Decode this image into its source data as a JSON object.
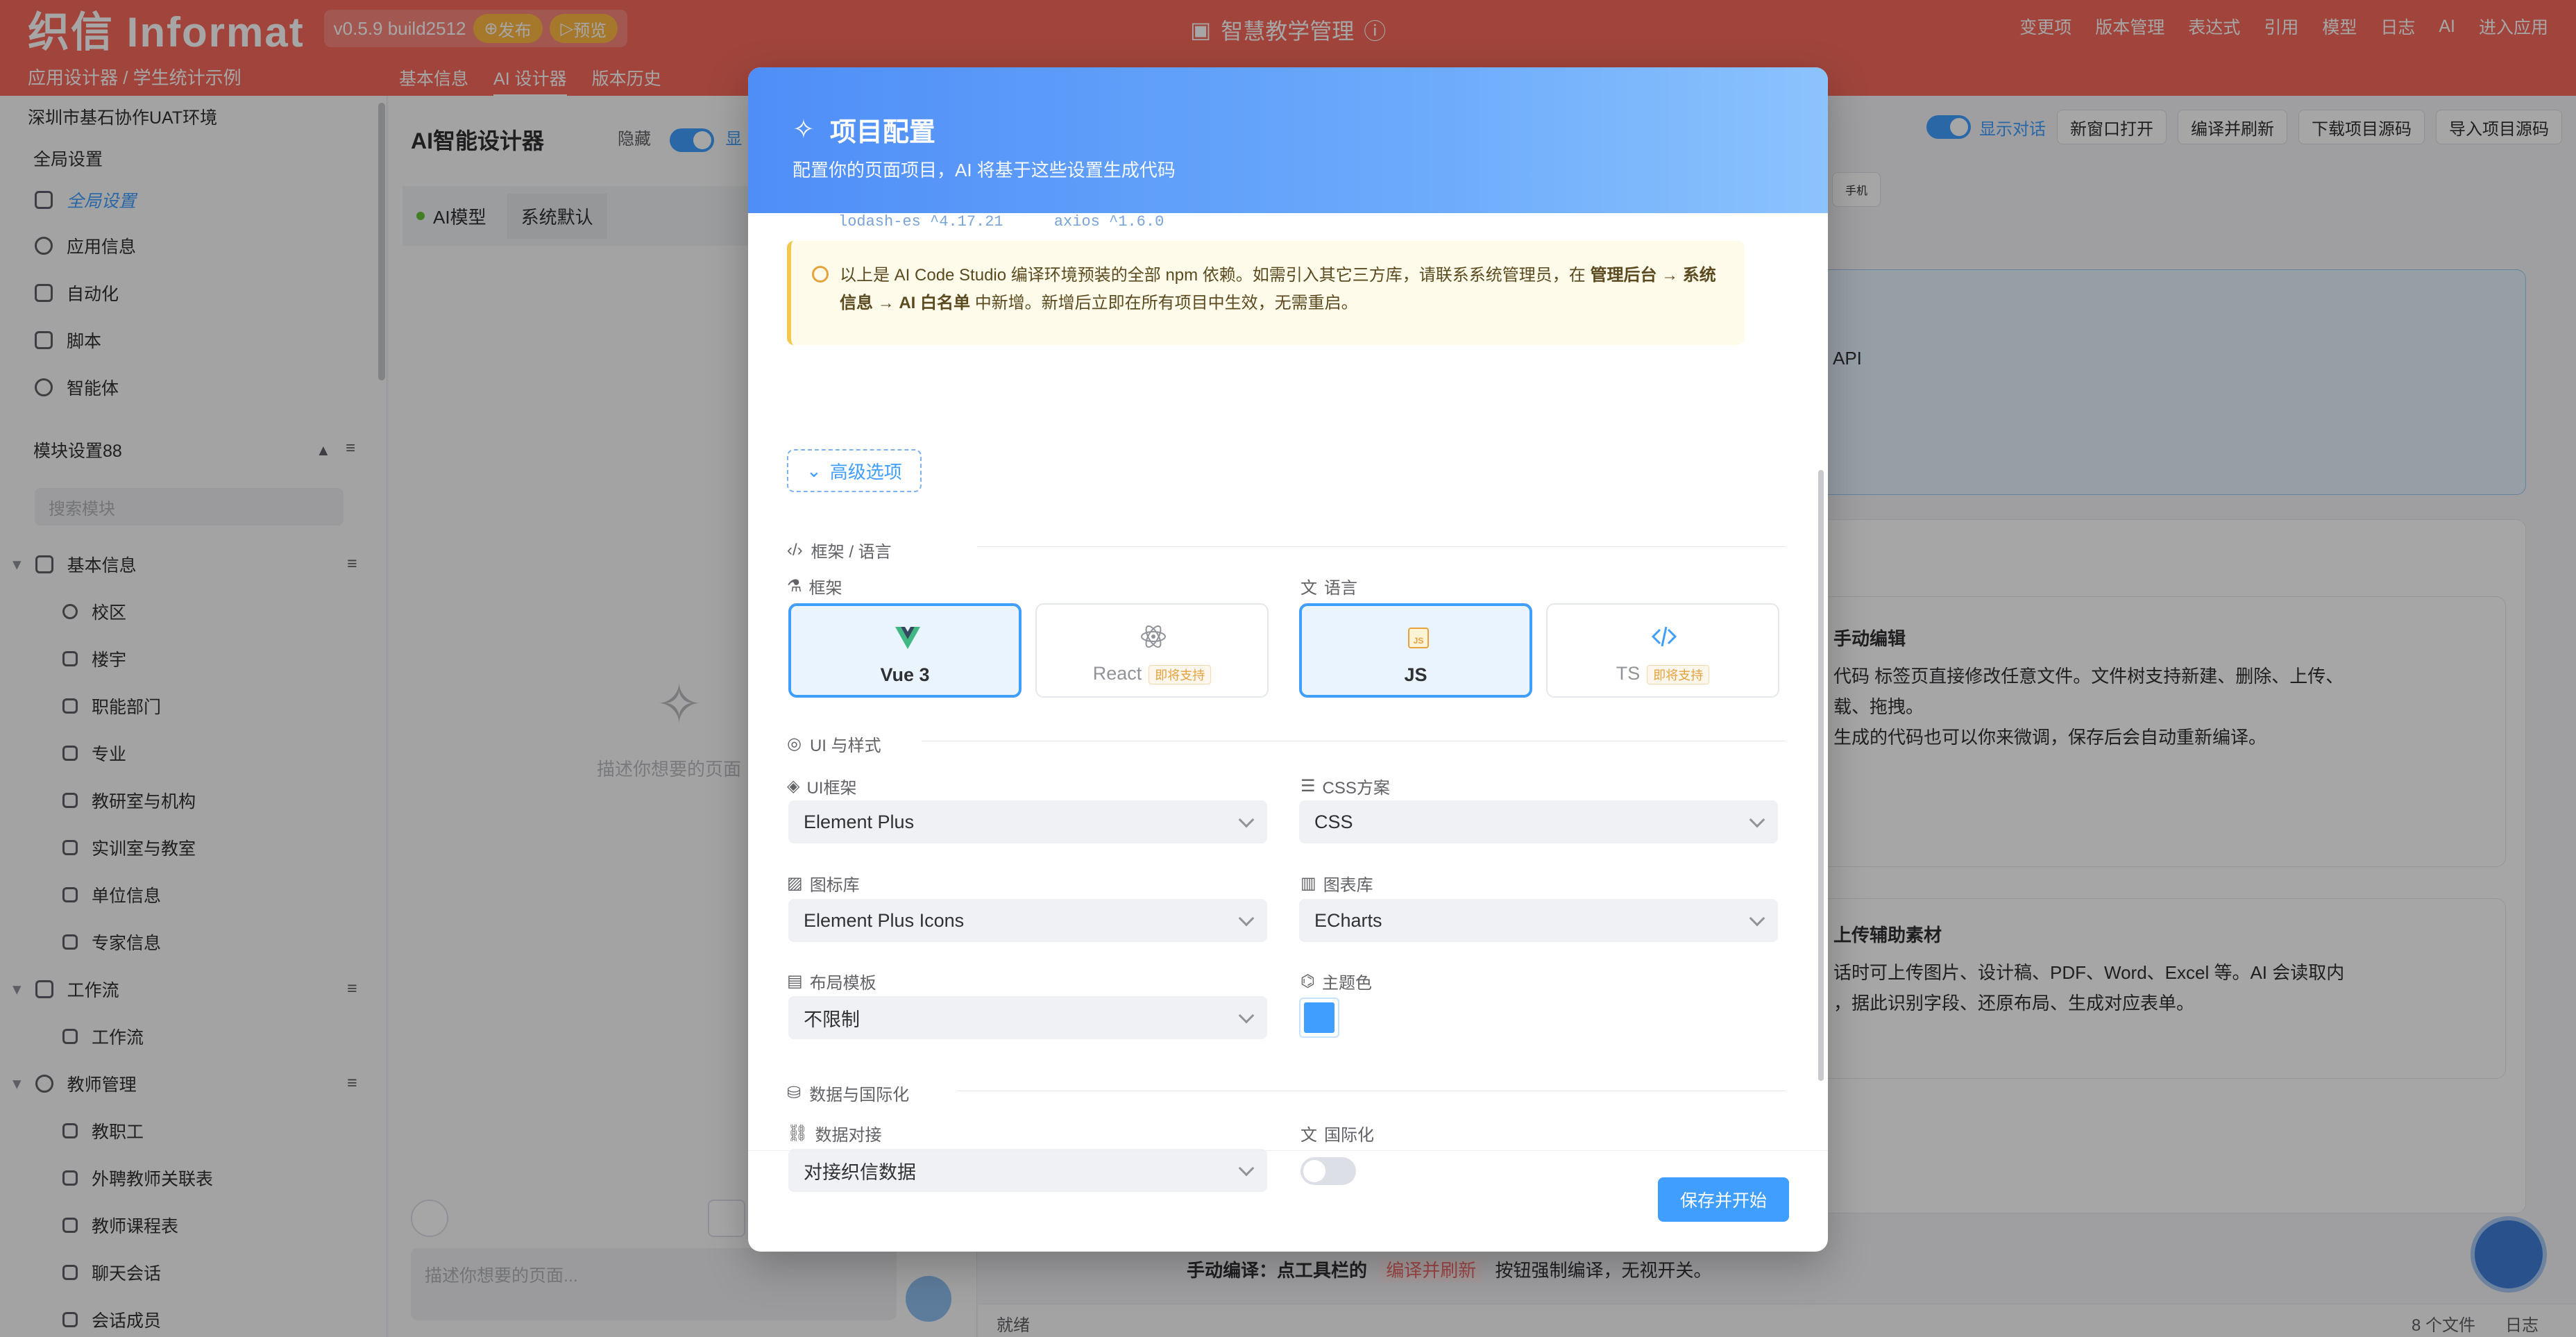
{
  "header": {
    "logo": "织信 Informat",
    "version": "v0.5.9 build2512",
    "publish": "发布",
    "preview": "预览",
    "app_title": "智慧教学管理",
    "menu": [
      "变更项",
      "版本管理",
      "表达式",
      "引用",
      "模型",
      "日志",
      "AI",
      "进入应用"
    ]
  },
  "subbar": {
    "breadcrumb": "应用设计器 / 学生统计示例",
    "tabs": [
      "基本信息",
      "AI 设计器",
      "版本历史"
    ]
  },
  "sidebar": {
    "env": "深圳市基石协作UAT环境",
    "global_title": "全局设置",
    "global_items": [
      "全局设置",
      "应用信息",
      "自动化",
      "脚本",
      "智能体"
    ],
    "module_title": "模块设置88",
    "search_placeholder": "搜索模块",
    "groups": [
      {
        "label": "基本信息",
        "items": [
          "校区",
          "楼宇",
          "职能部门",
          "专业",
          "教研室与机构",
          "实训室与教室",
          "单位信息",
          "专家信息"
        ]
      },
      {
        "label": "工作流",
        "items": [
          "工作流"
        ]
      },
      {
        "label": "教师管理",
        "items": [
          "教职工",
          "外聘教师关联表",
          "教师课程表",
          "聊天会话",
          "会话成员"
        ]
      }
    ]
  },
  "designer": {
    "title": "AI智能设计器",
    "hide_label": "隐藏",
    "show_partial": "显",
    "model_label": "AI模型",
    "model_value": "系统默认",
    "empty_text": "描述你想要的页面",
    "input_placeholder": "描述你想要的页面..."
  },
  "preview": {
    "show_dialog": "显示对话",
    "buttons": [
      "新窗口打开",
      "编译并刷新",
      "下载项目源码",
      "导入项目源码"
    ],
    "device": "手机",
    "api_text": "API",
    "manual_edit_title": "手动编辑",
    "manual_edit_lines": [
      "代码 标签页直接修改任意文件。文件树支持新建、删除、上传、",
      "载、拖拽。",
      "生成的代码也可以你来微调，保存后会自动重新编译。"
    ],
    "upload_title": "上传辅助素材",
    "upload_lines": [
      "话时可上传图片、设计稿、PDF、Word、Excel 等。AI 会读取内",
      "，据此识别字段、还原布局、生成对应表单。"
    ],
    "compile_line_prefix": "手动编译：点工具栏的",
    "compile_line_tag": "编译并刷新",
    "compile_line_suffix": "按钮强制编译，无视开关。",
    "status_ready": "就绪",
    "files_count": "8 个文件",
    "log": "日志"
  },
  "modal": {
    "title": "项目配置",
    "subtitle": "配置你的页面项目，AI 将基于这些设置生成代码",
    "npm_partial": [
      "lodash-es ^4.17.21",
      "axios ^1.6.0"
    ],
    "notice_prefix": "以上是 AI Code Studio 编译环境预装的全部 npm 依赖。如需引入其它三方库，请联系系统管理员，在",
    "notice_bold": "管理后台 → 系统信息 → AI 白名单",
    "notice_suffix": "中新增。新增后立即在所有项目中生效，无需重启。",
    "advanced": "高级选项",
    "section_framework": "框架 / 语言",
    "framework_label": "框架",
    "language_label": "语言",
    "framework_options": [
      {
        "label": "Vue 3",
        "active": true,
        "tag": ""
      },
      {
        "label": "React",
        "active": false,
        "tag": "即将支持"
      }
    ],
    "language_options": [
      {
        "label": "JS",
        "active": true,
        "tag": ""
      },
      {
        "label": "TS",
        "active": false,
        "tag": "即将支持"
      }
    ],
    "section_ui": "UI 与样式",
    "ui_framework_label": "UI框架",
    "ui_framework_value": "Element Plus",
    "css_label": "CSS方案",
    "css_value": "CSS",
    "icon_label": "图标库",
    "icon_value": "Element Plus Icons",
    "chart_label": "图表库",
    "chart_value": "ECharts",
    "layout_label": "布局模板",
    "layout_value": "不限制",
    "theme_label": "主题色",
    "theme_color": "#409eff",
    "section_data": "数据与国际化",
    "data_label": "数据对接",
    "data_value": "对接织信数据",
    "i18n_label": "国际化",
    "i18n_enabled": false,
    "save": "保存并开始"
  },
  "colors": {
    "brand": "#f86a5c",
    "primary": "#409eff",
    "warning": "#e6a23c"
  }
}
